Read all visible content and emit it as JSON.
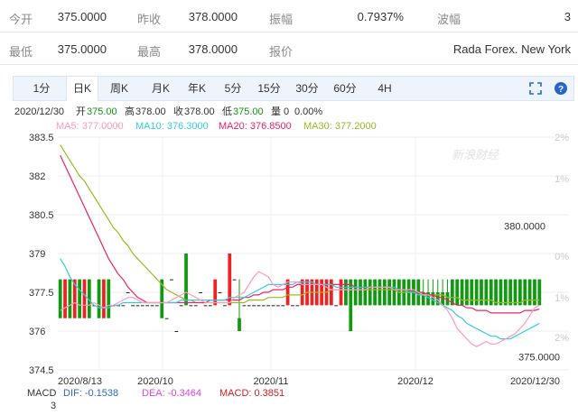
{
  "quote": {
    "open_label": "今开",
    "open_value": "375.0000",
    "prev_close_label": "昨收",
    "prev_close_value": "378.0000",
    "amplitude_label": "振幅",
    "amplitude_value": "0.7937%",
    "wave_label": "波幅",
    "wave_value": "3",
    "low_label": "最低",
    "low_value": "375.0000",
    "high_label": "最高",
    "high_value": "378.0000",
    "quoter_label": "报价",
    "quoter_value": "Rada Forex. New York"
  },
  "tabs": [
    "1分",
    "日K",
    "周K",
    "月K",
    "年K",
    "5分",
    "15分",
    "30分",
    "60分",
    "4H"
  ],
  "active_tab": "日K",
  "icons": {
    "fullscreen": "fullscreen-icon",
    "help": "help-icon"
  },
  "colors": {
    "up": "#ee2222",
    "down": "#119911",
    "neutral": "#222222",
    "ma5": "#ff99bb",
    "ma10": "#33ccdd",
    "ma20": "#ee2266",
    "ma30": "#99bb22",
    "macd_dif": "#3366cc",
    "macd_dea": "#dd44dd",
    "macd_val": "#cc2222",
    "date_color": "#333333"
  },
  "info_line": {
    "date": "2020/12/30",
    "open_label": "开",
    "open": "375.00",
    "high_label": "高",
    "high": "378.00",
    "close_label": "收",
    "close": "378.00",
    "low_label": "低",
    "low": "375.00",
    "volume_label": "量",
    "volume": "0",
    "change": "0.00%"
  },
  "ma_line": {
    "ma5": "MA5: 377.0000",
    "ma10": "MA10: 376.3000",
    "ma20": "MA20: 376.8500",
    "ma30": "MA30: 377.2000"
  },
  "watermark": "新浪财经",
  "macd_line": {
    "label": "MACD",
    "dif": "DIF: -0.1538",
    "dea": "DEA: -0.3464",
    "macd": "MACD: 0.3851",
    "sub_value": "3"
  },
  "chart_data": {
    "type": "candlestick",
    "y_ticks": [
      "383.5",
      "382",
      "380.5",
      "379",
      "377.5",
      "376",
      "374.5"
    ],
    "ylim": [
      374.5,
      383.5
    ],
    "pct_ticks": [
      "2%",
      "1%",
      "0%",
      "1%",
      "2%"
    ],
    "x_labels": [
      "2020/8/13",
      "2020/10",
      "2020/11",
      "2020/12",
      "2020/12/30"
    ],
    "max_label": "380.0000",
    "min_label": "375.0000",
    "candles": [
      {
        "o": 378,
        "h": 378,
        "l": 376.5,
        "c": 376.5
      },
      {
        "o": 376.5,
        "h": 378,
        "l": 376.5,
        "c": 378
      },
      {
        "o": 378,
        "h": 378,
        "l": 376.5,
        "c": 376.5
      },
      {
        "o": 376.5,
        "h": 378,
        "l": 376.5,
        "c": 378
      },
      {
        "o": 378,
        "h": 378,
        "l": 376.5,
        "c": 376.5
      },
      {
        "o": 376.5,
        "h": 378,
        "l": 376.5,
        "c": 378
      },
      {
        "o": 378,
        "h": 378,
        "l": 376.5,
        "c": 376.5
      },
      {
        "o": 377,
        "h": 377,
        "l": 377,
        "c": 377
      },
      {
        "o": 378,
        "h": 378,
        "l": 376.5,
        "c": 376.5
      },
      {
        "o": 376.5,
        "h": 378,
        "l": 376.5,
        "c": 378
      },
      {
        "o": 378,
        "h": 378,
        "l": 376.5,
        "c": 376.5
      },
      {
        "o": 377,
        "h": 377,
        "l": 377,
        "c": 377
      },
      {
        "o": 377,
        "h": 377,
        "l": 377,
        "c": 377
      },
      {
        "o": 377,
        "h": 377,
        "l": 377,
        "c": 377
      },
      {
        "o": 377.5,
        "h": 377.5,
        "l": 377.5,
        "c": 377.5
      },
      {
        "o": 377,
        "h": 377,
        "l": 377,
        "c": 377
      },
      {
        "o": 377,
        "h": 377,
        "l": 377,
        "c": 377
      },
      {
        "o": 377,
        "h": 377,
        "l": 377,
        "c": 377
      },
      {
        "o": 377,
        "h": 377,
        "l": 377,
        "c": 377
      },
      {
        "o": 377,
        "h": 377,
        "l": 377,
        "c": 377
      },
      {
        "o": 377,
        "h": 377,
        "l": 377,
        "c": 377
      },
      {
        "o": 378,
        "h": 378,
        "l": 376.5,
        "c": 376.5
      },
      {
        "o": 376.5,
        "h": 376.5,
        "l": 376.5,
        "c": 376.5
      },
      {
        "o": 378,
        "h": 378,
        "l": 378,
        "c": 378
      },
      {
        "o": 376,
        "h": 376,
        "l": 376,
        "c": 376
      },
      {
        "o": 377,
        "h": 377,
        "l": 377,
        "c": 377
      },
      {
        "o": 379,
        "h": 379,
        "l": 377,
        "c": 377
      },
      {
        "o": 377,
        "h": 377,
        "l": 377,
        "c": 377
      },
      {
        "o": 377,
        "h": 377,
        "l": 377,
        "c": 377
      },
      {
        "o": 377.5,
        "h": 377.5,
        "l": 377.5,
        "c": 377.5
      },
      {
        "o": 377,
        "h": 377,
        "l": 377,
        "c": 377
      },
      {
        "o": 377,
        "h": 377,
        "l": 377,
        "c": 377
      },
      {
        "o": 377,
        "h": 378,
        "l": 377,
        "c": 378
      },
      {
        "o": 377.5,
        "h": 377.5,
        "l": 377.5,
        "c": 377.5
      },
      {
        "o": 377,
        "h": 377,
        "l": 377,
        "c": 377
      },
      {
        "o": 377,
        "h": 379,
        "l": 377,
        "c": 379
      },
      {
        "o": 378,
        "h": 378,
        "l": 378,
        "c": 378
      },
      {
        "o": 376.5,
        "h": 378,
        "l": 376,
        "c": 376
      },
      {
        "o": 377,
        "h": 377,
        "l": 377,
        "c": 377
      },
      {
        "o": 377,
        "h": 377,
        "l": 377,
        "c": 377
      },
      {
        "o": 377,
        "h": 377,
        "l": 377,
        "c": 377
      },
      {
        "o": 377,
        "h": 377,
        "l": 377,
        "c": 377
      },
      {
        "o": 377,
        "h": 377,
        "l": 377,
        "c": 377
      },
      {
        "o": 377,
        "h": 377,
        "l": 377,
        "c": 377
      },
      {
        "o": 377,
        "h": 377,
        "l": 377,
        "c": 377
      },
      {
        "o": 377,
        "h": 377,
        "l": 377,
        "c": 377
      },
      {
        "o": 377,
        "h": 377,
        "l": 377,
        "c": 377
      },
      {
        "o": 377,
        "h": 378,
        "l": 377,
        "c": 378
      },
      {
        "o": 377,
        "h": 377,
        "l": 377,
        "c": 377
      },
      {
        "o": 377,
        "h": 377,
        "l": 377,
        "c": 377
      },
      {
        "o": 377,
        "h": 378,
        "l": 377,
        "c": 378
      },
      {
        "o": 377,
        "h": 378,
        "l": 377,
        "c": 378
      },
      {
        "o": 377,
        "h": 378,
        "l": 377,
        "c": 378
      },
      {
        "o": 377,
        "h": 378,
        "l": 377,
        "c": 378
      },
      {
        "o": 377,
        "h": 378,
        "l": 377,
        "c": 378
      },
      {
        "o": 377,
        "h": 378,
        "l": 377,
        "c": 378
      },
      {
        "o": 377,
        "h": 378,
        "l": 377,
        "c": 378
      },
      {
        "o": 377,
        "h": 377,
        "l": 377,
        "c": 377
      },
      {
        "o": 377,
        "h": 378,
        "l": 377,
        "c": 378
      },
      {
        "o": 378,
        "h": 378,
        "l": 377,
        "c": 377
      },
      {
        "o": 378,
        "h": 378,
        "l": 376,
        "c": 376
      },
      {
        "o": 378,
        "h": 378,
        "l": 377,
        "c": 377
      },
      {
        "o": 378,
        "h": 378,
        "l": 377,
        "c": 377
      },
      {
        "o": 378,
        "h": 378,
        "l": 377,
        "c": 377
      },
      {
        "o": 378,
        "h": 378,
        "l": 377,
        "c": 377
      },
      {
        "o": 378,
        "h": 378,
        "l": 377,
        "c": 377
      },
      {
        "o": 378,
        "h": 378,
        "l": 377,
        "c": 377
      },
      {
        "o": 378,
        "h": 378,
        "l": 377,
        "c": 377
      },
      {
        "o": 378,
        "h": 378,
        "l": 377,
        "c": 377
      },
      {
        "o": 378,
        "h": 378,
        "l": 377,
        "c": 377
      },
      {
        "o": 378,
        "h": 378,
        "l": 377,
        "c": 377
      },
      {
        "o": 378,
        "h": 378,
        "l": 377,
        "c": 377
      },
      {
        "o": 378,
        "h": 378,
        "l": 377,
        "c": 377
      },
      {
        "o": 378,
        "h": 378,
        "l": 377,
        "c": 377
      },
      {
        "o": 378,
        "h": 378,
        "l": 377,
        "c": 377
      },
      {
        "o": 377.5,
        "h": 378,
        "l": 377,
        "c": 377
      },
      {
        "o": 377.5,
        "h": 378,
        "l": 377,
        "c": 377
      },
      {
        "o": 377.5,
        "h": 378,
        "l": 377,
        "c": 377
      },
      {
        "o": 377.5,
        "h": 378,
        "l": 377,
        "c": 377
      },
      {
        "o": 377.5,
        "h": 378,
        "l": 377,
        "c": 377
      },
      {
        "o": 377.5,
        "h": 378,
        "l": 377,
        "c": 377
      },
      {
        "o": 378,
        "h": 378,
        "l": 377,
        "c": 377
      },
      {
        "o": 378,
        "h": 378,
        "l": 377,
        "c": 377
      },
      {
        "o": 378,
        "h": 378,
        "l": 377,
        "c": 377
      },
      {
        "o": 378,
        "h": 378,
        "l": 377,
        "c": 377
      },
      {
        "o": 378,
        "h": 378,
        "l": 377,
        "c": 377
      },
      {
        "o": 378,
        "h": 378,
        "l": 377,
        "c": 377
      },
      {
        "o": 378,
        "h": 378,
        "l": 377,
        "c": 377
      },
      {
        "o": 378,
        "h": 378,
        "l": 377,
        "c": 377
      },
      {
        "o": 378,
        "h": 378,
        "l": 377,
        "c": 377
      },
      {
        "o": 378,
        "h": 378,
        "l": 377,
        "c": 377
      },
      {
        "o": 378,
        "h": 378,
        "l": 377,
        "c": 377
      },
      {
        "o": 378,
        "h": 378,
        "l": 377,
        "c": 377
      },
      {
        "o": 378,
        "h": 378,
        "l": 377,
        "c": 377
      },
      {
        "o": 378,
        "h": 378,
        "l": 377,
        "c": 377
      },
      {
        "o": 378,
        "h": 378,
        "l": 377,
        "c": 377
      },
      {
        "o": 378,
        "h": 378,
        "l": 377,
        "c": 377
      },
      {
        "o": 378,
        "h": 378,
        "l": 377,
        "c": 377
      },
      {
        "o": 378,
        "h": 378,
        "l": 377,
        "c": 377
      },
      {
        "o": 378,
        "h": 378,
        "l": 377,
        "c": 377
      }
    ],
    "ma5": [
      376.8,
      376.9,
      377.0,
      377.1,
      377.0,
      377.0,
      377.0,
      377.1,
      377.0,
      376.9,
      377.0,
      377.0,
      377.1,
      377.2,
      377.3,
      377.3,
      377.2,
      377.1,
      377.1,
      377.1,
      377.1,
      377.1,
      377.1,
      377.2,
      377.3,
      377.4,
      377.5,
      377.4,
      377.3,
      377.2,
      377.1,
      377.1,
      377.1,
      377.1,
      377.1,
      377.1,
      377.3,
      377.4,
      377.5,
      377.8,
      378.1,
      378.3,
      378.2,
      378.1,
      377.8,
      377.7,
      377.8,
      377.9,
      377.9,
      377.9,
      377.8,
      377.8,
      377.8,
      377.8,
      377.8,
      377.7,
      377.6,
      377.6,
      377.6,
      377.6,
      377.6,
      377.6,
      377.6,
      377.6,
      377.7,
      377.7,
      377.7,
      377.7,
      377.7,
      377.6,
      377.6,
      377.6,
      377.6,
      377.6,
      377.5,
      377.4,
      377.4,
      377.3,
      377.2,
      377.0,
      376.8,
      376.5,
      376.1,
      375.9,
      375.7,
      375.5,
      375.4,
      375.5,
      375.6,
      375.5,
      375.5,
      375.6,
      375.7,
      375.8,
      375.9,
      376.1,
      376.3,
      376.6,
      376.9,
      377.0
    ],
    "ma10": [
      378.8,
      378.5,
      378.1,
      377.8,
      377.6,
      377.4,
      377.2,
      377.0,
      376.9,
      376.9,
      376.9,
      377.0,
      377.0,
      377.1,
      377.1,
      377.1,
      377.1,
      377.1,
      377.1,
      377.1,
      377.1,
      377.1,
      377.1,
      377.1,
      377.1,
      377.2,
      377.2,
      377.2,
      377.2,
      377.2,
      377.2,
      377.2,
      377.2,
      377.2,
      377.2,
      377.3,
      377.3,
      377.3,
      377.3,
      377.4,
      377.5,
      377.6,
      377.7,
      377.8,
      377.8,
      377.8,
      377.8,
      377.8,
      377.8,
      377.9,
      377.9,
      377.9,
      377.9,
      377.8,
      377.8,
      377.8,
      377.8,
      377.7,
      377.7,
      377.7,
      377.7,
      377.7,
      377.7,
      377.7,
      377.7,
      377.7,
      377.7,
      377.7,
      377.7,
      377.7,
      377.6,
      377.6,
      377.5,
      377.5,
      377.4,
      377.4,
      377.3,
      377.2,
      377.1,
      377.0,
      376.9,
      376.8,
      376.6,
      376.5,
      376.3,
      376.2,
      376.1,
      376.0,
      375.9,
      375.8,
      375.8,
      375.7,
      375.7,
      375.7,
      375.8,
      375.9,
      376.0,
      376.1,
      376.2,
      376.3
    ],
    "ma20": [
      382.8,
      382.4,
      382.0,
      381.6,
      381.2,
      380.8,
      380.4,
      380.0,
      379.6,
      379.2,
      378.8,
      378.5,
      378.2,
      378.0,
      377.7,
      377.5,
      377.3,
      377.2,
      377.1,
      377.1,
      377.1,
      377.1,
      377.1,
      377.1,
      377.1,
      377.1,
      377.1,
      377.1,
      377.1,
      377.1,
      377.1,
      377.2,
      377.2,
      377.2,
      377.2,
      377.2,
      377.2,
      377.2,
      377.3,
      377.3,
      377.4,
      377.4,
      377.5,
      377.5,
      377.6,
      377.6,
      377.6,
      377.7,
      377.7,
      377.8,
      377.8,
      377.8,
      377.8,
      377.8,
      377.8,
      377.8,
      377.8,
      377.8,
      377.8,
      377.8,
      377.8,
      377.7,
      377.7,
      377.7,
      377.7,
      377.7,
      377.7,
      377.7,
      377.7,
      377.6,
      377.6,
      377.6,
      377.6,
      377.5,
      377.5,
      377.5,
      377.4,
      377.4,
      377.3,
      377.3,
      377.2,
      377.1,
      377.0,
      377.0,
      376.9,
      376.9,
      376.8,
      376.8,
      376.8,
      376.7,
      376.7,
      376.7,
      376.7,
      376.7,
      376.7,
      376.7,
      376.8,
      376.8,
      376.8,
      376.85
    ],
    "ma30": [
      383.2,
      382.9,
      382.6,
      382.3,
      382.0,
      381.8,
      381.5,
      381.2,
      380.9,
      380.6,
      380.3,
      380.0,
      379.8,
      379.5,
      379.3,
      379.0,
      378.8,
      378.6,
      378.4,
      378.2,
      378.0,
      377.8,
      377.6,
      377.5,
      377.4,
      377.3,
      377.2,
      377.2,
      377.1,
      377.1,
      377.1,
      377.1,
      377.1,
      377.1,
      377.1,
      377.1,
      377.1,
      377.1,
      377.1,
      377.2,
      377.2,
      377.2,
      377.2,
      377.3,
      377.3,
      377.3,
      377.3,
      377.4,
      377.4,
      377.4,
      377.4,
      377.5,
      377.5,
      377.5,
      377.5,
      377.5,
      377.6,
      377.6,
      377.6,
      377.6,
      377.6,
      377.6,
      377.6,
      377.6,
      377.6,
      377.6,
      377.6,
      377.6,
      377.6,
      377.6,
      377.5,
      377.5,
      377.5,
      377.5,
      377.5,
      377.4,
      377.4,
      377.4,
      377.4,
      377.4,
      377.3,
      377.3,
      377.3,
      377.2,
      377.2,
      377.2,
      377.2,
      377.2,
      377.2,
      377.2,
      377.1,
      377.1,
      377.1,
      377.1,
      377.1,
      377.1,
      377.2,
      377.2,
      377.2,
      377.2
    ]
  }
}
